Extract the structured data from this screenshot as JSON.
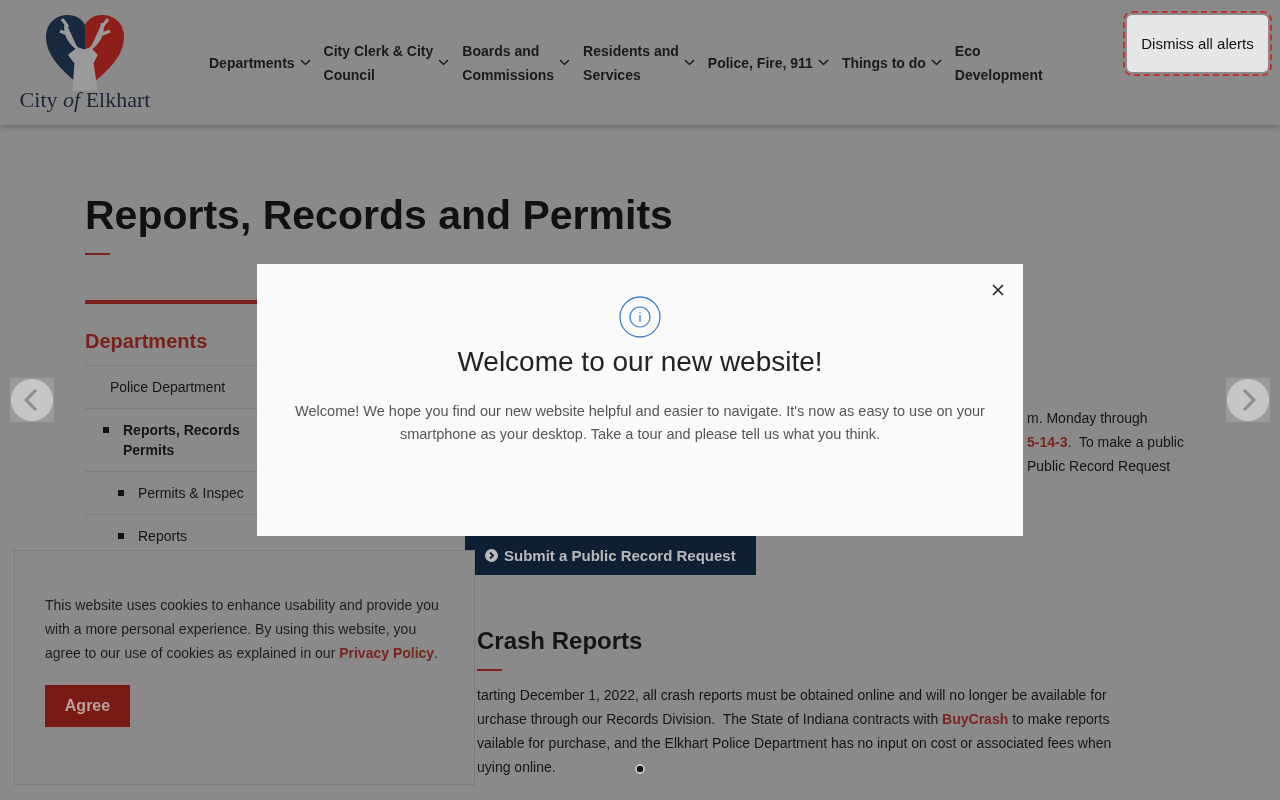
{
  "header": {
    "logo_text": "City *of* Elkhart",
    "nav": [
      {
        "lines": [
          "Departments"
        ],
        "dropdown": true
      },
      {
        "lines": [
          "City Clerk & City",
          "Council"
        ],
        "dropdown": true
      },
      {
        "lines": [
          "Boards and",
          "Commissions"
        ],
        "dropdown": true
      },
      {
        "lines": [
          "Residents and",
          "Services"
        ],
        "dropdown": true
      },
      {
        "lines": [
          "Police, Fire, 911"
        ],
        "dropdown": true
      },
      {
        "lines": [
          "Things to do"
        ],
        "dropdown": true
      },
      {
        "lines": [
          "Eco",
          "Development"
        ],
        "dropdown": false
      }
    ]
  },
  "alerts_button": "Dismiss all alerts",
  "page_title": "Reports, Records and Permits",
  "sidebar": {
    "heading": "Departments",
    "items": [
      {
        "lines": [
          "Police Department"
        ],
        "selected": false,
        "children": [
          {
            "lines": [
              "Reports, Records",
              "Permits"
            ],
            "selected": true,
            "children": [
              {
                "lines": [
                  "Permits & Inspec"
                ],
                "selected": false
              },
              {
                "lines": [
                  "Reports"
                ],
                "selected": false
              }
            ]
          }
        ]
      }
    ]
  },
  "intro_lines": [
    [
      {
        "kind": "text",
        "text": "m. Monday through"
      }
    ],
    [
      {
        "kind": "link",
        "text": "5-14-3"
      },
      {
        "kind": "text",
        "text": ".  To make a public"
      }
    ],
    [
      {
        "kind": "text",
        "text": "Public Record Request"
      }
    ]
  ],
  "submit_button": "Submit a Public Record Request",
  "crash": {
    "heading": "Crash Reports",
    "lines": [
      [
        {
          "kind": "text",
          "text": "tarting December 1, 2022, all crash reports must be obtained online and will no longer be available for"
        }
      ],
      [
        {
          "kind": "text",
          "text": "urchase through our Records Division.  The State of Indiana contracts with "
        },
        {
          "kind": "link",
          "text": "BuyCrash"
        },
        {
          "kind": "text",
          "text": " to make reports"
        }
      ],
      [
        {
          "kind": "text",
          "text": "vailable for purchase, and the Elkhart Police Department has no input on cost or associated fees when"
        }
      ],
      [
        {
          "kind": "text",
          "text": "uying online."
        }
      ]
    ]
  },
  "cookie_banner": {
    "text": "This website uses cookies to enhance usability and provide you with a more personal experience. By using this website, you agree to our use of cookies as explained in our ",
    "link": "Privacy Policy",
    "after": ".",
    "button": "Agree"
  },
  "modal": {
    "title": "Welcome to our new website!",
    "body": "Welcome! We hope you find our new website helpful and easier to navigate. It's now as easy to use on your smartphone as your desktop. Take a tour and please tell us what you think."
  }
}
